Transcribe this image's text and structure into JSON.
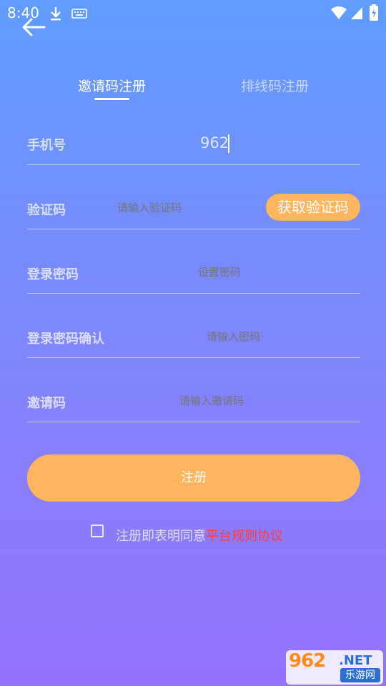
{
  "status_bar": {
    "time": "8:40",
    "icons": [
      "download-icon",
      "keyboard-icon",
      "wifi-icon",
      "signal-icon",
      "battery-charging-icon"
    ]
  },
  "tabs": [
    {
      "label": "邀请码注册",
      "active": true
    },
    {
      "label": "排线码注册",
      "active": false
    }
  ],
  "form": {
    "phone": {
      "label": "手机号",
      "value": "962"
    },
    "code": {
      "label": "验证码",
      "placeholder": "请输入验证码",
      "button_label": "获取验证码"
    },
    "password": {
      "label": "登录密码",
      "placeholder": "设置密码"
    },
    "password_confirm": {
      "label": "登录密码确认",
      "placeholder": "请输入密码"
    },
    "invite": {
      "label": "邀请码",
      "placeholder": "请输入邀请码"
    }
  },
  "register_button": {
    "label": "注册"
  },
  "agreement": {
    "checked": false,
    "text": "注册即表明同意",
    "link": "平台规则协议"
  },
  "watermark": {
    "number": "962",
    "domain": ".NET",
    "site": "乐游网"
  },
  "colors": {
    "bg_top": "#5f9cfe",
    "bg_bottom": "#9672fd",
    "accent": "#ffb55e",
    "link": "#ff3b3b"
  }
}
